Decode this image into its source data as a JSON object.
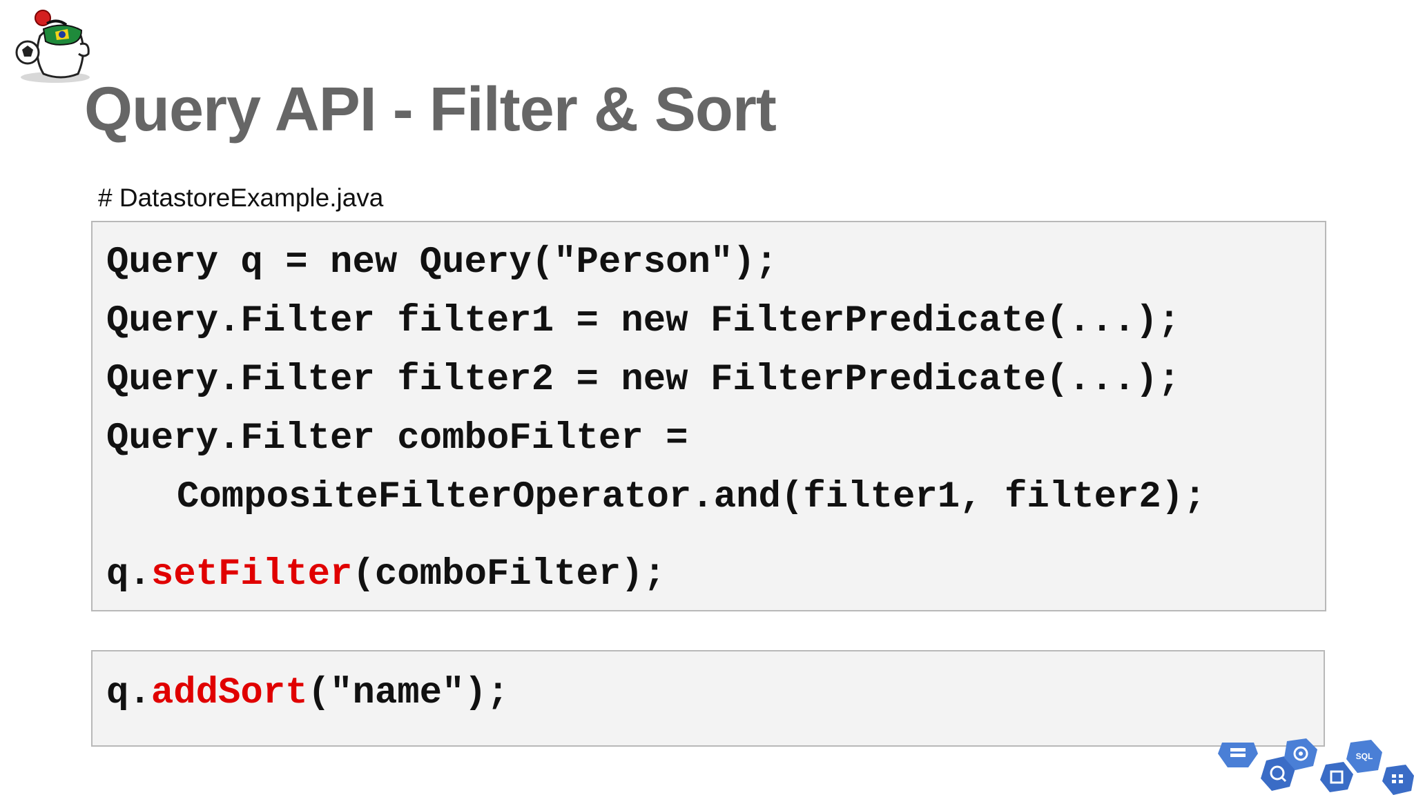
{
  "slide": {
    "title": "Query API - Filter & Sort",
    "filename": "# DatastoreExample.java"
  },
  "code_main": {
    "lines": [
      {
        "text": "Query q = new Query(\"Person\");"
      },
      {
        "text": "Query.Filter filter1 = new FilterPredicate(...);"
      },
      {
        "text": "Query.Filter filter2 = new FilterPredicate(...);"
      },
      {
        "text": "Query.Filter comboFilter ="
      },
      {
        "text": "CompositeFilterOperator.and(filter1, filter2);"
      }
    ],
    "set_filter": {
      "prefix": "q.",
      "method": "setFilter",
      "suffix": "(comboFilter);"
    }
  },
  "code_sort": {
    "prefix": "q.",
    "method": "addSort",
    "suffix": "(\"name\");"
  },
  "icons": {
    "mascot": "java-duke-mascot-icon",
    "cluster": [
      "storage-icon",
      "search-icon",
      "settings-icon",
      "chip-icon",
      "sql-icon",
      "grid-icon"
    ],
    "sql_label": "SQL"
  },
  "colors": {
    "title": "#666666",
    "method_highlight": "#e00000",
    "code_bg": "#f3f3f3",
    "hex_blue": "#4a7fd6"
  }
}
